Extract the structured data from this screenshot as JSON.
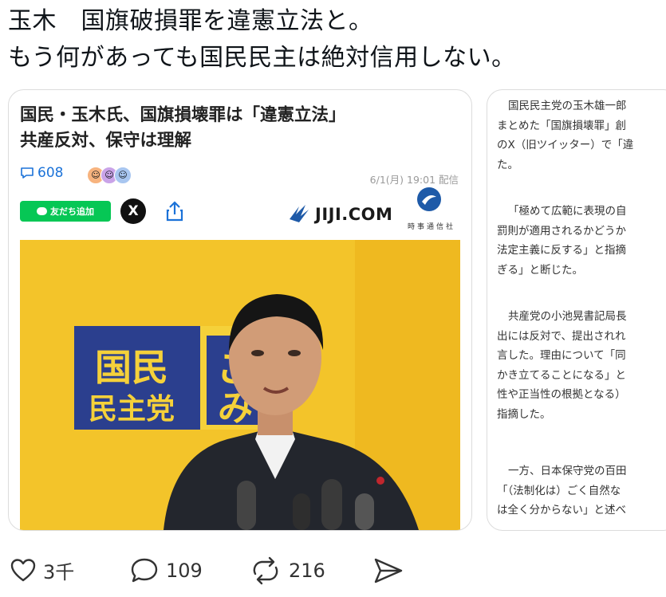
{
  "post": {
    "lines": [
      "玉木　国旗破損罪を違憲立法と。",
      "もう何があっても国民民主は絶対信用しない。"
    ]
  },
  "article": {
    "headline_lines": [
      "国民・玉木氏、国旗損壊罪は「違憲立法」",
      "共産反対、保守は理解"
    ],
    "comment_count": "608",
    "date": "6/1(月) 19:01 配信",
    "line_button": "友だち追加",
    "x_button": "X",
    "brand": "JIJI.COM",
    "brand_sub": "時事通信社",
    "photo_sign": {
      "main": [
        "国民",
        "民主党"
      ],
      "side": [
        "こ",
        "み"
      ]
    },
    "colors": {
      "photo_bg": "#f3c42a",
      "sign_blue": "#2b3f8e",
      "line_green": "#06c755",
      "link_blue": "#1b72d8"
    }
  },
  "side_article": {
    "paragraphs": [
      [
        "国民民主党の玉木雄一郎",
        "まとめた「国旗損壊罪」創",
        "のX（旧ツイッター）で「違",
        "た。"
      ],
      [
        "「極めて広範に表現の自",
        "罰則が適用されるかどうか",
        "法定主義に反する」と指摘",
        "ぎる」と断じた。"
      ],
      [
        "共産党の小池晃書記局長",
        "出には反対で、提出されれ",
        "言した。理由について「同",
        "かき立てることになる」と",
        "性や正当性の根拠となる）",
        "指摘した。"
      ],
      [
        "一方、日本保守党の百田",
        "「（法制化は）ごく自然な",
        "は全く分からない」と述べ"
      ]
    ]
  },
  "actions": {
    "likes": "3千",
    "replies": "109",
    "reposts": "216",
    "icons": [
      "heart-icon",
      "reply-icon",
      "repost-icon",
      "send-icon"
    ]
  }
}
